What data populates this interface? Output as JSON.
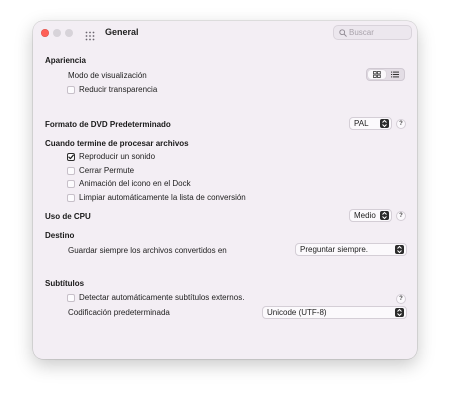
{
  "window": {
    "title": "General",
    "search_placeholder": "Buscar"
  },
  "appearance": {
    "header": "Apariencia",
    "view_mode_label": "Modo de visualización",
    "view_mode_selected": "grid",
    "reduce_transparency_label": "Reducir transparencia",
    "reduce_transparency_checked": false
  },
  "dvd_format": {
    "label": "Formato de DVD Predeterminado",
    "value": "PAL",
    "help": "?"
  },
  "on_finish": {
    "header": "Cuando termine de procesar archivos",
    "options": [
      {
        "label": "Reproducir un sonido",
        "checked": true
      },
      {
        "label": "Cerrar Permute",
        "checked": false
      },
      {
        "label": "Animación del icono en el Dock",
        "checked": false
      },
      {
        "label": "Limpiar automáticamente la lista de conversión",
        "checked": false
      }
    ]
  },
  "cpu": {
    "label": "Uso de CPU",
    "value": "Medio",
    "help": "?"
  },
  "destination": {
    "header": "Destino",
    "label": "Guardar siempre los archivos convertidos en",
    "value": "Preguntar siempre."
  },
  "subtitles": {
    "header": "Subtítulos",
    "auto_detect_label": "Detectar automáticamente subtítulos externos.",
    "auto_detect_checked": false,
    "help": "?",
    "encoding_label": "Codificación predeterminada",
    "encoding_value": "Unicode (UTF-8)"
  },
  "colors": {
    "window_bg": "#f3eef4",
    "close_red": "#fe5f57",
    "inactive_gray": "#d7d3d9"
  }
}
